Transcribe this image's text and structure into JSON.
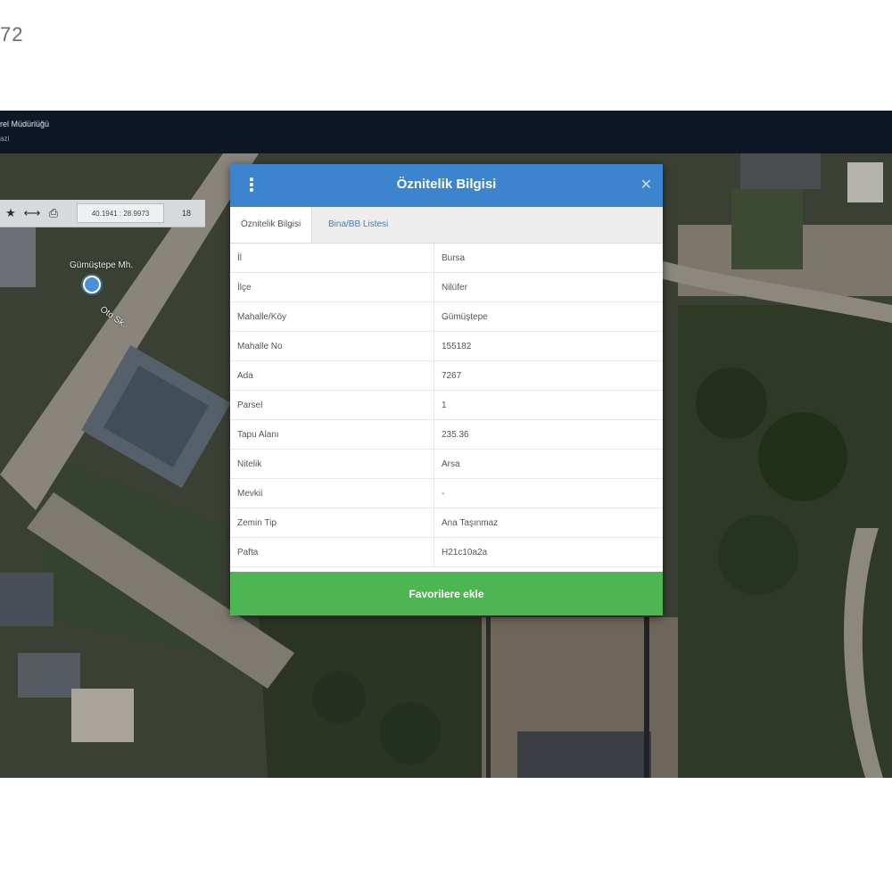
{
  "corner_number": "72",
  "app": {
    "title": "rel Müdürlüğü",
    "subtitle": "azi"
  },
  "toolbar": {
    "icons": [
      "star-icon",
      "measure-icon",
      "print-icon"
    ],
    "coordinates": "40.1941 : 28.9973",
    "zoom": "18"
  },
  "map": {
    "labels": [
      "Gümüştepe Mh.",
      "Oto Sk."
    ]
  },
  "modal": {
    "menu_icon": "⋮",
    "title": "Öznitelik Bilgisi",
    "close_icon": "✕",
    "tabs": [
      {
        "label": "Öznitelik Bilgisi",
        "active": true
      },
      {
        "label": "Bina/BB Listesi",
        "active": false
      }
    ],
    "rows": [
      {
        "key": "İl",
        "value": "Bursa"
      },
      {
        "key": "İlçe",
        "value": "Nilüfer"
      },
      {
        "key": "Mahalle/Köy",
        "value": "Gümüştepe"
      },
      {
        "key": "Mahalle No",
        "value": "155182"
      },
      {
        "key": "Ada",
        "value": "7267"
      },
      {
        "key": "Parsel",
        "value": "1"
      },
      {
        "key": "Tapu Alanı",
        "value": "235.36"
      },
      {
        "key": "Nitelik",
        "value": "Arsa"
      },
      {
        "key": "Mevkii",
        "value": "-"
      },
      {
        "key": "Zemin Tip",
        "value": "Ana Taşınmaz"
      },
      {
        "key": "Pafta",
        "value": "H21c10a2a"
      }
    ],
    "favorite_button": "Favorilere ekle"
  },
  "colors": {
    "header_blue": "#3d84cf",
    "button_green": "#4db551",
    "topbar_navy": "#0d1726"
  }
}
